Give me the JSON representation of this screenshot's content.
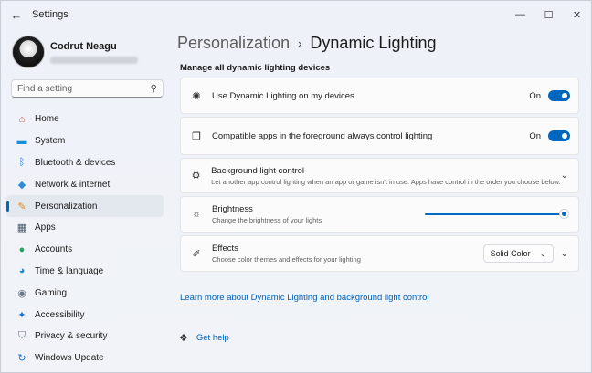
{
  "window": {
    "title": "Settings",
    "back_icon": "back-arrow-icon",
    "minimize_glyph": "—",
    "maximize_glyph": "☐",
    "close_glyph": "✕"
  },
  "profile": {
    "name": "Codrut Neagu"
  },
  "search": {
    "placeholder": "Find a setting",
    "icon": "search-icon"
  },
  "sidebar": {
    "items": [
      {
        "label": "Home",
        "icon": "home-icon",
        "glyph": "⌂",
        "color": "#d9534f",
        "selected": false
      },
      {
        "label": "System",
        "icon": "monitor-icon",
        "glyph": "▬",
        "color": "#1a8cd8",
        "selected": false
      },
      {
        "label": "Bluetooth & devices",
        "icon": "bluetooth-icon",
        "glyph": "ᛒ",
        "color": "#1a73d8",
        "selected": false
      },
      {
        "label": "Network & internet",
        "icon": "wifi-icon",
        "glyph": "◆",
        "color": "#2b8fd6",
        "selected": false
      },
      {
        "label": "Personalization",
        "icon": "paintbrush-icon",
        "glyph": "✎",
        "color": "#e08a1e",
        "selected": true
      },
      {
        "label": "Apps",
        "icon": "apps-icon",
        "glyph": "▦",
        "color": "#4d5a6b",
        "selected": false
      },
      {
        "label": "Accounts",
        "icon": "person-icon",
        "glyph": "●",
        "color": "#2aa45c",
        "selected": false
      },
      {
        "label": "Time & language",
        "icon": "globe-clock-icon",
        "glyph": "◕",
        "color": "#1f8ad0",
        "selected": false
      },
      {
        "label": "Gaming",
        "icon": "gamepad-icon",
        "glyph": "◉",
        "color": "#6b7685",
        "selected": false
      },
      {
        "label": "Accessibility",
        "icon": "accessibility-icon",
        "glyph": "✦",
        "color": "#1a6fd0",
        "selected": false
      },
      {
        "label": "Privacy & security",
        "icon": "shield-icon",
        "glyph": "⛉",
        "color": "#6b7685",
        "selected": false
      },
      {
        "label": "Windows Update",
        "icon": "update-icon",
        "glyph": "↻",
        "color": "#1a73d8",
        "selected": false
      }
    ]
  },
  "breadcrumb": {
    "parent": "Personalization",
    "separator": "›",
    "current": "Dynamic Lighting"
  },
  "section_title": "Manage all dynamic lighting devices",
  "settings": {
    "use_dynamic": {
      "icon": "sun-burst-icon",
      "glyph": "✺",
      "title": "Use Dynamic Lighting on my devices",
      "state_label": "On",
      "enabled": true
    },
    "compatible_apps": {
      "icon": "apps-lighting-icon",
      "glyph": "❐",
      "title": "Compatible apps in the foreground always control lighting",
      "state_label": "On",
      "enabled": true
    },
    "background_control": {
      "icon": "gear-icon",
      "glyph": "⚙",
      "title": "Background light control",
      "subtitle": "Let another app control lighting when an app or game isn't in use. Apps have control in the order you choose below."
    },
    "brightness": {
      "icon": "brightness-icon",
      "glyph": "☼",
      "title": "Brightness",
      "subtitle": "Change the brightness of your lights",
      "level_percent": 100
    },
    "effects": {
      "icon": "pen-icon",
      "glyph": "✐",
      "title": "Effects",
      "subtitle": "Choose color themes and effects for your lighting",
      "selected": "Solid Color"
    }
  },
  "links": {
    "learn_more": "Learn more about Dynamic Lighting and background light control",
    "help": "Get help",
    "help_icon": "help-chat-icon"
  },
  "colors": {
    "accent": "#0067c0",
    "link": "#005fb8"
  }
}
